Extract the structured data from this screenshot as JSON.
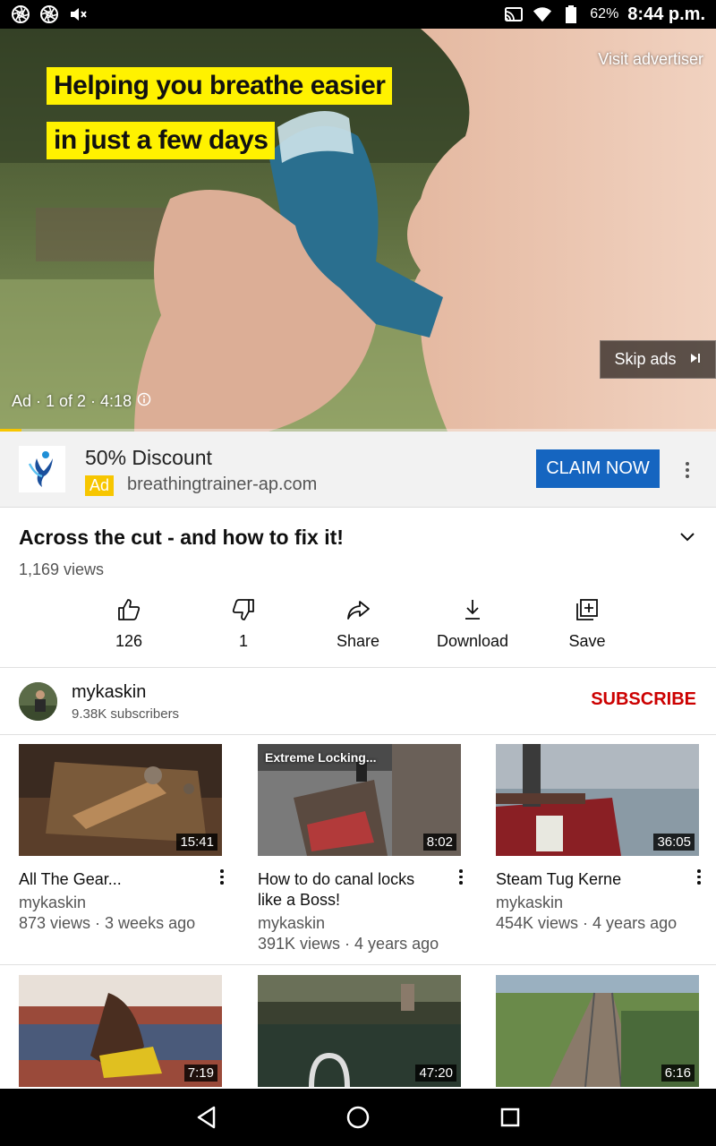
{
  "status_bar": {
    "battery_percent": "62%",
    "time": "8:44 p.m."
  },
  "player": {
    "caption_line1": "Helping you breathe easier",
    "caption_line2": "in just a few days",
    "visit_advertiser": "Visit advertiser",
    "skip_label": "Skip ads",
    "ad_info": "Ad · 1 of 2 · 4:18",
    "progress_fraction": 0.03
  },
  "ad_banner": {
    "title": "50% Discount",
    "tag": "Ad",
    "url": "breathingtrainer-ap.com",
    "cta": "CLAIM NOW"
  },
  "video": {
    "title": "Across the cut - and how to fix it!",
    "views": "1,169 views",
    "actions": [
      {
        "label": "126",
        "icon": "thumbs-up-icon"
      },
      {
        "label": "1",
        "icon": "thumbs-down-icon"
      },
      {
        "label": "Share",
        "icon": "share-icon"
      },
      {
        "label": "Download",
        "icon": "download-icon"
      },
      {
        "label": "Save",
        "icon": "save-playlist-icon"
      }
    ]
  },
  "channel": {
    "name": "mykaskin",
    "subscribers": "9.38K subscribers",
    "subscribe_label": "SUBSCRIBE"
  },
  "recommended": [
    {
      "title": "All The Gear...",
      "channel": "mykaskin",
      "meta": "873 views · 3 weeks ago",
      "duration": "15:41",
      "thumb_text": ""
    },
    {
      "title": "How to do canal locks like a Boss!",
      "channel": "mykaskin",
      "meta": "391K views · 4 years ago",
      "duration": "8:02",
      "thumb_text": "Extreme Locking..."
    },
    {
      "title": "Steam Tug Kerne",
      "channel": "mykaskin",
      "meta": "454K views · 4 years ago",
      "duration": "36:05",
      "thumb_text": ""
    },
    {
      "duration": "7:19"
    },
    {
      "duration": "47:20"
    },
    {
      "duration": "6:16"
    }
  ],
  "colors": {
    "accent_blue": "#1565c0",
    "subscribe_red": "#cc0000",
    "ad_yellow": "#f7c600"
  }
}
